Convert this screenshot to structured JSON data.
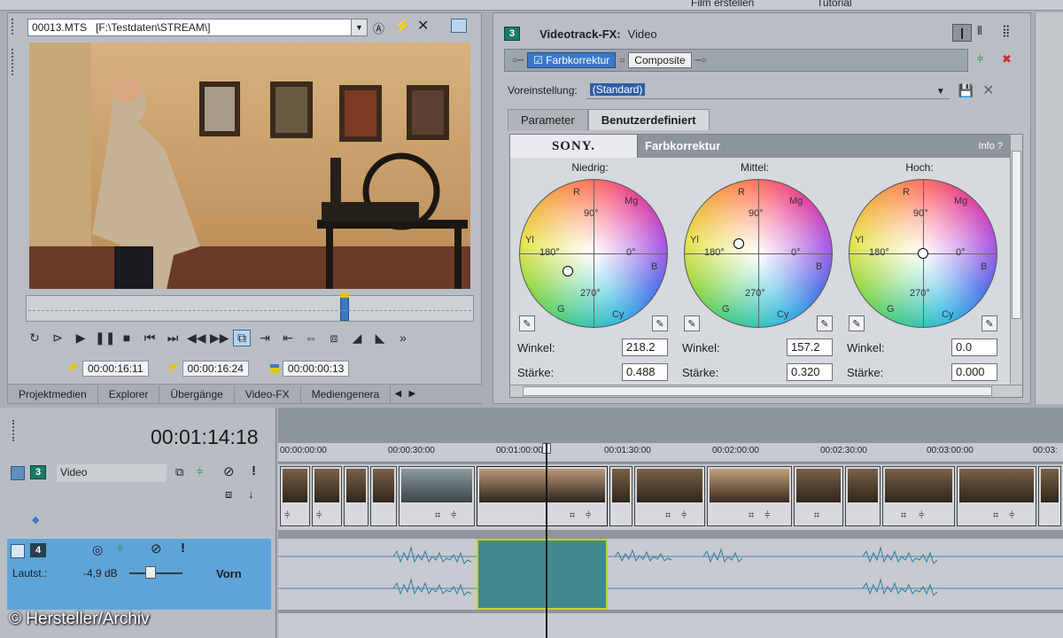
{
  "toolbar": {
    "make_movie": "Film erstellen",
    "tutorial": "Tutorial"
  },
  "preview": {
    "file": "00013.MTS",
    "path": "[F:\\Testdaten\\STREAM\\]",
    "timecode_in": "00:00:16:11",
    "timecode_out": "00:00:16:24",
    "timecode_len": "00:00:00:13"
  },
  "bottom_tabs": [
    "Projektmedien",
    "Explorer",
    "Übergänge",
    "Video-FX",
    "Mediengenera"
  ],
  "fx": {
    "track_num": "3",
    "title": "Videotrack-FX:",
    "track_name": "Video",
    "chain": [
      "Farbkorrektur",
      "Composite"
    ],
    "preset_label": "Voreinstellung:",
    "preset_value": "(Standard)",
    "tabs": [
      "Parameter",
      "Benutzerdefiniert"
    ],
    "brand": "SONY.",
    "plugin": "Farbkorrektur",
    "info": "Info  ?",
    "wheels": [
      {
        "label": "Niedrig:",
        "angle_label": "Winkel:",
        "angle": "218.2",
        "strength_label": "Stärke:",
        "strength": "0.488"
      },
      {
        "label": "Mittel:",
        "angle_label": "Winkel:",
        "angle": "157.2",
        "strength_label": "Stärke:",
        "strength": "0.320"
      },
      {
        "label": "Hoch:",
        "angle_label": "Winkel:",
        "angle": "0.0",
        "strength_label": "Stärke:",
        "strength": "0.000"
      }
    ],
    "wheel_marks": {
      "r": "R",
      "mg": "Mg",
      "b": "B",
      "cy": "Cy",
      "g": "G",
      "yl": "Yl",
      "d90": "90°",
      "d180": "180°",
      "d0": "0°",
      "d270": "270°"
    }
  },
  "timeline": {
    "position": "00:01:14:18",
    "ruler": [
      "00:00:00:00",
      "00:00:30:00",
      "00:01:00:00",
      "00:01:30:00",
      "00:02:00:00",
      "00:02:30:00",
      "00:03:00:00",
      "00:03:"
    ],
    "video_track": {
      "num": "3",
      "name": "Video"
    },
    "audio_track": {
      "num": "4",
      "vol_label": "Lautst.:",
      "vol": "-4,9 dB",
      "mode": "Vorn"
    }
  },
  "watermark": "© Hersteller/Archiv"
}
